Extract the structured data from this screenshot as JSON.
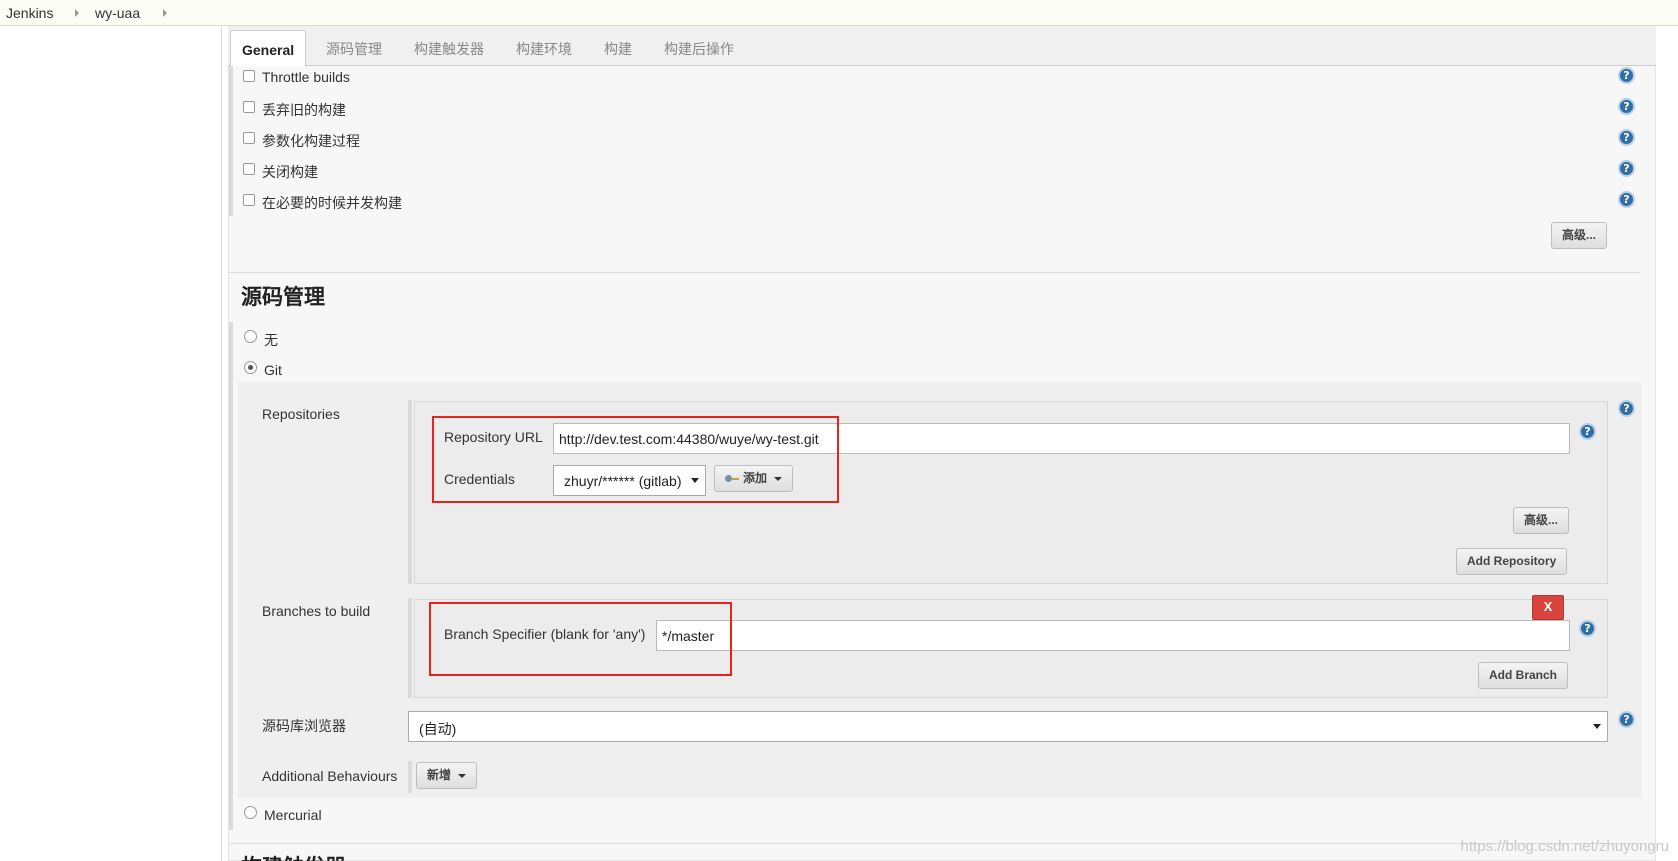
{
  "breadcrumb": [
    "Jenkins",
    "wy-uaa"
  ],
  "tabs": [
    "General",
    "源码管理",
    "构建触发器",
    "构建环境",
    "构建",
    "构建后操作"
  ],
  "general_options": [
    "Throttle builds",
    "丢弃旧的构建",
    "参数化构建过程",
    "关闭构建",
    "在必要的时候并发构建"
  ],
  "advanced_label": "高级...",
  "scm": {
    "title": "源码管理",
    "options": [
      "无",
      "Git",
      "Mercurial"
    ],
    "selected": "Git",
    "repositories_label": "Repositories",
    "repo_url_label": "Repository URL",
    "repo_url_value": "http://dev.test.com:44380/wuye/wy-test.git",
    "credentials_label": "Credentials",
    "credentials_value": "zhuyr/****** (gitlab)",
    "add_label": "添加",
    "add_repository_label": "Add Repository",
    "branches_label": "Branches to build",
    "branch_specifier_label": "Branch Specifier (blank for 'any')",
    "branch_specifier_value": "*/master",
    "delete_branch_label": "X",
    "add_branch_label": "Add Branch",
    "browser_label": "源码库浏览器",
    "browser_value": "(自动)",
    "additional_behaviours_label": "Additional Behaviours",
    "new_label": "新增"
  },
  "next_section_title": "构建触发器",
  "watermark": "https://blog.csdn.net/zhuyongru",
  "colors": {
    "highlight": "#e8221d",
    "help_icon": "#2f6ea6",
    "delete_button": "#d9453c"
  }
}
